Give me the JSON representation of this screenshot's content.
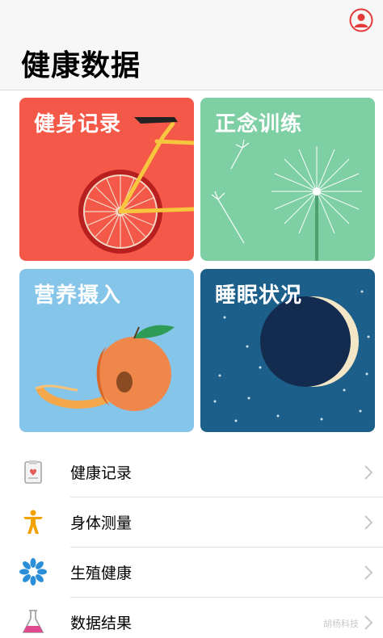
{
  "header": {
    "title": "健康数据",
    "profile_icon": "profile-icon"
  },
  "tiles": [
    {
      "label": "健身记录",
      "color": "#f45848",
      "icon": "bicycle-illustration"
    },
    {
      "label": "正念训练",
      "color": "#7fcfa5",
      "icon": "dandelion-illustration"
    },
    {
      "label": "营养摄入",
      "color": "#86c5ea",
      "icon": "peach-illustration"
    },
    {
      "label": "睡眠状况",
      "color": "#1c5f8a",
      "icon": "moon-illustration"
    }
  ],
  "list": [
    {
      "label": "健康记录",
      "icon": "clipboard-icon"
    },
    {
      "label": "身体测量",
      "icon": "body-figure-icon"
    },
    {
      "label": "生殖健康",
      "icon": "flower-icon"
    },
    {
      "label": "数据结果",
      "icon": "flask-icon"
    }
  ],
  "watermark": "胡杨科技"
}
